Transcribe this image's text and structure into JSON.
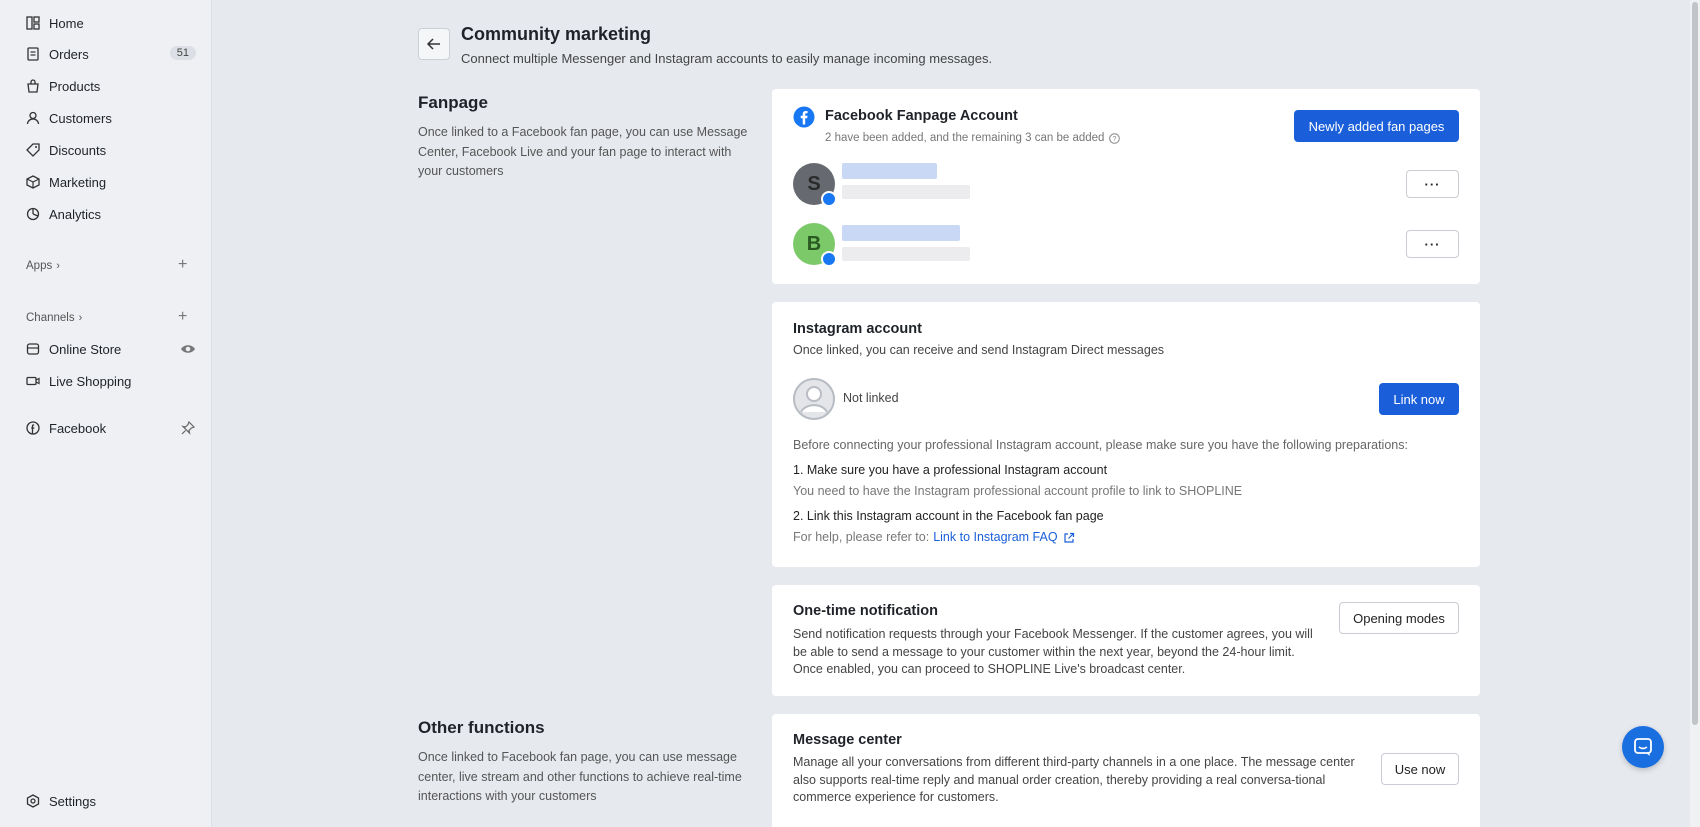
{
  "sidebar": {
    "items": [
      {
        "label": "Home",
        "icon": "home-icon"
      },
      {
        "label": "Orders",
        "icon": "orders-icon",
        "badge": "51"
      },
      {
        "label": "Products",
        "icon": "products-icon"
      },
      {
        "label": "Customers",
        "icon": "customers-icon"
      },
      {
        "label": "Discounts",
        "icon": "discounts-icon"
      },
      {
        "label": "Marketing",
        "icon": "marketing-icon"
      },
      {
        "label": "Analytics",
        "icon": "analytics-icon"
      }
    ],
    "apps_label": "Apps",
    "channels_label": "Channels",
    "channels": [
      {
        "label": "Online Store",
        "icon": "store-icon"
      },
      {
        "label": "Live Shopping",
        "icon": "video-icon"
      }
    ],
    "facebook_label": "Facebook",
    "settings_label": "Settings"
  },
  "header": {
    "title": "Community marketing",
    "subtitle": "Connect multiple Messenger and Instagram accounts to easily manage incoming messages."
  },
  "fanpage_section": {
    "title": "Fanpage",
    "description": "Once linked to a Facebook fan page, you can use Message Center, Facebook Live and your fan page to interact with your customers"
  },
  "fanpage_card": {
    "title": "Facebook Fanpage Account",
    "subtitle": "2 have been added, and the remaining 3 can be added",
    "button": "Newly added fan pages",
    "pages": [
      {
        "initial": "S",
        "color": "#666a70"
      },
      {
        "initial": "B",
        "color": "#7cc96a"
      }
    ],
    "more_label": "···"
  },
  "instagram_card": {
    "title": "Instagram account",
    "description": "Once linked, you can receive and send Instagram Direct messages",
    "status": "Not linked",
    "button": "Link now",
    "prep_intro": "Before connecting your professional Instagram account, please make sure you have the following preparations:",
    "step1_title": "1. Make sure you have a professional Instagram account",
    "step1_desc": "You need to have the Instagram professional account profile to link to SHOPLINE",
    "step2_title": "2. Link this Instagram account in the Facebook fan page",
    "help_prefix": "For help, please refer to:",
    "help_link": "Link to Instagram FAQ"
  },
  "otn_card": {
    "title": "One-time notification",
    "description": "Send notification requests through your Facebook Messenger. If the customer agrees, you will be able to send a message to your customer within the next year, beyond the 24-hour limit. Once enabled, you can proceed to SHOPLINE Live's broadcast center.",
    "button": "Opening modes"
  },
  "other_section": {
    "title": "Other functions",
    "description": "Once linked to Facebook fan page, you can use message center, live stream and other functions to achieve real-time interactions with your customers"
  },
  "message_card": {
    "title": "Message center",
    "description": "Manage all your conversations from different third-party channels in a one place. The message center also supports real-time reply and manual order creation, thereby providing a real conversa-tional commerce experience for customers.",
    "button": "Use now"
  },
  "colors": {
    "primary": "#1a5fd9",
    "facebook": "#1877f2",
    "background": "#e6e9ee"
  }
}
